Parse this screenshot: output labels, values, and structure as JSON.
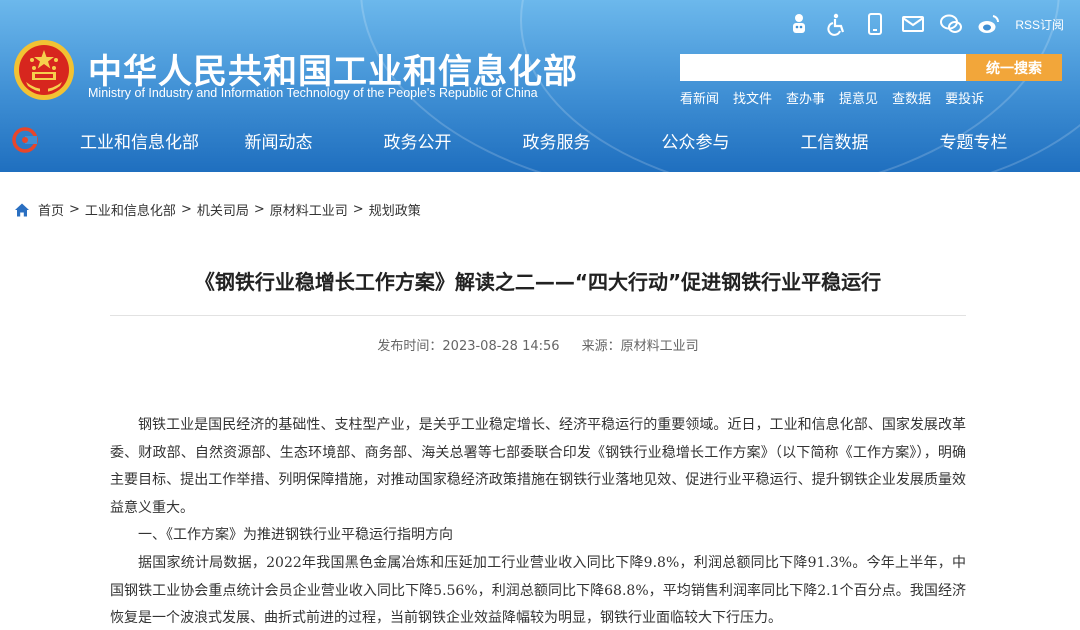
{
  "header": {
    "site_name_cn": "中华人民共和国工业和信息化部",
    "site_name_en": "Ministry of Industry and Information Technology of the People's Republic of China",
    "utility_icons": [
      "robot-assistant-icon",
      "accessibility-icon",
      "mobile-icon",
      "email-icon",
      "wechat-icon",
      "weibo-icon"
    ],
    "rss_label": "RSS订阅"
  },
  "search": {
    "placeholder": "",
    "value": "",
    "button_label": "统一搜索"
  },
  "quick_links": [
    "看新闻",
    "找文件",
    "查办事",
    "提意见",
    "查数据",
    "要投诉"
  ],
  "nav": {
    "items": [
      "工业和信息化部",
      "新闻动态",
      "政务公开",
      "政务服务",
      "公众参与",
      "工信数据",
      "专题专栏"
    ]
  },
  "breadcrumb": {
    "items": [
      "首页",
      "工业和信息化部",
      "机关司局",
      "原材料工业司",
      "规划政策"
    ],
    "separator": ">"
  },
  "article": {
    "title": "《钢铁行业稳增长工作方案》解读之二——“四大行动”促进钢铁行业平稳运行",
    "publish_label": "发布时间：",
    "publish_time": "2023-08-28 14:56",
    "source_label": "来源：",
    "source": "原材料工业司",
    "paragraphs": [
      "钢铁工业是国民经济的基础性、支柱型产业，是关乎工业稳定增长、经济平稳运行的重要领域。近日，工业和信息化部、国家发展改革委、财政部、自然资源部、生态环境部、商务部、海关总署等七部委联合印发《钢铁行业稳增长工作方案》（以下简称《工作方案》），明确主要目标、提出工作举措、列明保障措施，对推动国家稳经济政策措施在钢铁行业落地见效、促进行业平稳运行、提升钢铁企业发展质量效益意义重大。",
      "一、《工作方案》为推进钢铁行业平稳运行指明方向",
      "据国家统计局数据，2022年我国黑色金属冶炼和压延加工行业营业收入同比下降9.8%，利润总额同比下降91.3%。今年上半年，中国钢铁工业协会重点统计会员企业营业收入同比下降5.56%，利润总额同比下降68.8%，平均销售利润率同比下降2.1个百分点。我国经济恢复是一个波浪式发展、曲折式前进的过程，当前钢铁企业效益降幅较为明显，钢铁行业面临较大下行压力。"
    ]
  },
  "colors": {
    "header_top": "#6cb8ec",
    "header_bottom": "#1f6fbf",
    "search_button": "#f2a63a",
    "breadcrumb_home_icon": "#2a6fc1"
  }
}
